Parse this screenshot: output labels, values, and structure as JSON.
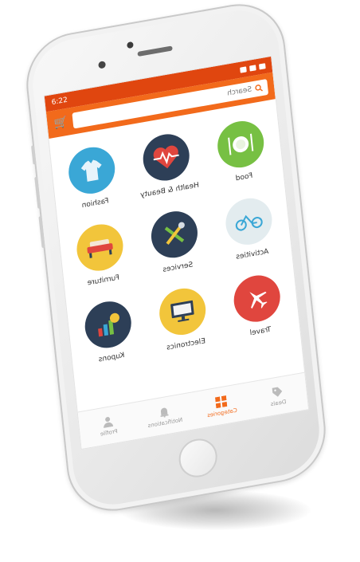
{
  "status_bar": {
    "time": "6:22",
    "carrier_icons": "signal-wifi-battery"
  },
  "search": {
    "placeholder": "Search"
  },
  "categories": [
    {
      "label": "Fashion",
      "icon": "shirt-icon",
      "color": "#3aa7d6"
    },
    {
      "label": "Health & Beauty",
      "icon": "heart-pulse-icon",
      "color": "#2d3f57"
    },
    {
      "label": "Food",
      "icon": "plate-icon",
      "color": "#77c043"
    },
    {
      "label": "Furniture",
      "icon": "sofa-icon",
      "color": "#f2c53b"
    },
    {
      "label": "Services",
      "icon": "tools-icon",
      "color": "#2d3f57"
    },
    {
      "label": "Activities",
      "icon": "bicycle-icon",
      "color": "#e3ecef"
    },
    {
      "label": "Kupons",
      "icon": "coupon-icon",
      "color": "#2d3f57"
    },
    {
      "label": "Electronics",
      "icon": "monitor-icon",
      "color": "#f2c53b"
    },
    {
      "label": "Travel",
      "icon": "airplane-icon",
      "color": "#e0463e"
    }
  ],
  "tabs": [
    {
      "label": "Profile",
      "icon": "user-icon"
    },
    {
      "label": "Notifications",
      "icon": "bell-icon"
    },
    {
      "label": "Categories",
      "icon": "grid-icon",
      "active": true
    },
    {
      "label": "Deals",
      "icon": "tag-icon"
    }
  ],
  "colors": {
    "accent": "#f26a1b",
    "statusbar": "#e0460f"
  }
}
